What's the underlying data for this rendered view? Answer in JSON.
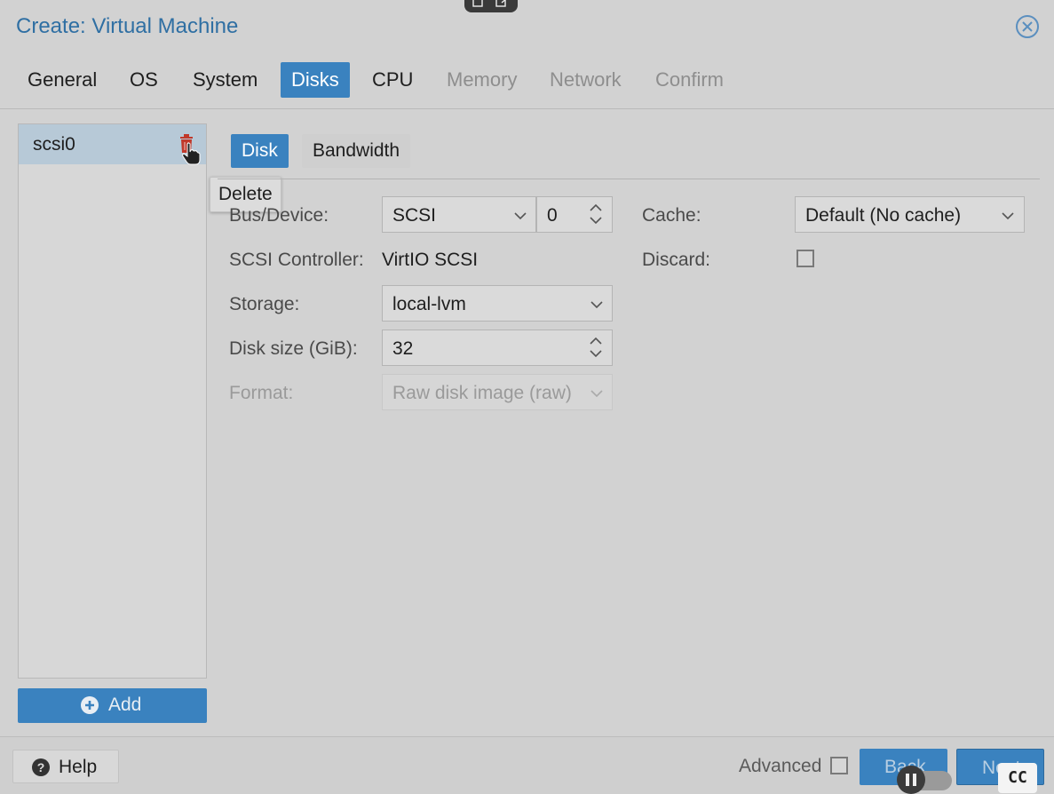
{
  "window": {
    "title": "Create: Virtual Machine"
  },
  "tabs": [
    {
      "label": "General",
      "state": "enabled"
    },
    {
      "label": "OS",
      "state": "enabled"
    },
    {
      "label": "System",
      "state": "enabled"
    },
    {
      "label": "Disks",
      "state": "active"
    },
    {
      "label": "CPU",
      "state": "enabled"
    },
    {
      "label": "Memory",
      "state": "disabled"
    },
    {
      "label": "Network",
      "state": "disabled"
    },
    {
      "label": "Confirm",
      "state": "disabled"
    }
  ],
  "disk_list": {
    "items": [
      {
        "label": "scsi0",
        "selected": true
      }
    ],
    "delete_tooltip": "Delete",
    "add_label": "Add"
  },
  "subtabs": [
    {
      "label": "Disk",
      "active": true
    },
    {
      "label": "Bandwidth",
      "active": false
    }
  ],
  "form": {
    "bus_device": {
      "label": "Bus/Device:",
      "bus": "SCSI",
      "device": "0"
    },
    "scsi_controller": {
      "label": "SCSI Controller:",
      "value": "VirtIO SCSI"
    },
    "storage": {
      "label": "Storage:",
      "value": "local-lvm"
    },
    "disk_size": {
      "label": "Disk size (GiB):",
      "value": "32"
    },
    "format": {
      "label": "Format:",
      "value": "Raw disk image (raw)",
      "disabled": true
    },
    "cache": {
      "label": "Cache:",
      "value": "Default (No cache)"
    },
    "discard": {
      "label": "Discard:",
      "checked": false
    }
  },
  "footer": {
    "help_label": "Help",
    "advanced_label": "Advanced",
    "advanced_checked": false,
    "back_label": "Back",
    "next_label": "Next"
  },
  "overlay": {
    "cc_label": "CC"
  },
  "colors": {
    "accent": "#3a82bf",
    "title": "#2f6fa3",
    "delete_icon": "#c0392b"
  }
}
